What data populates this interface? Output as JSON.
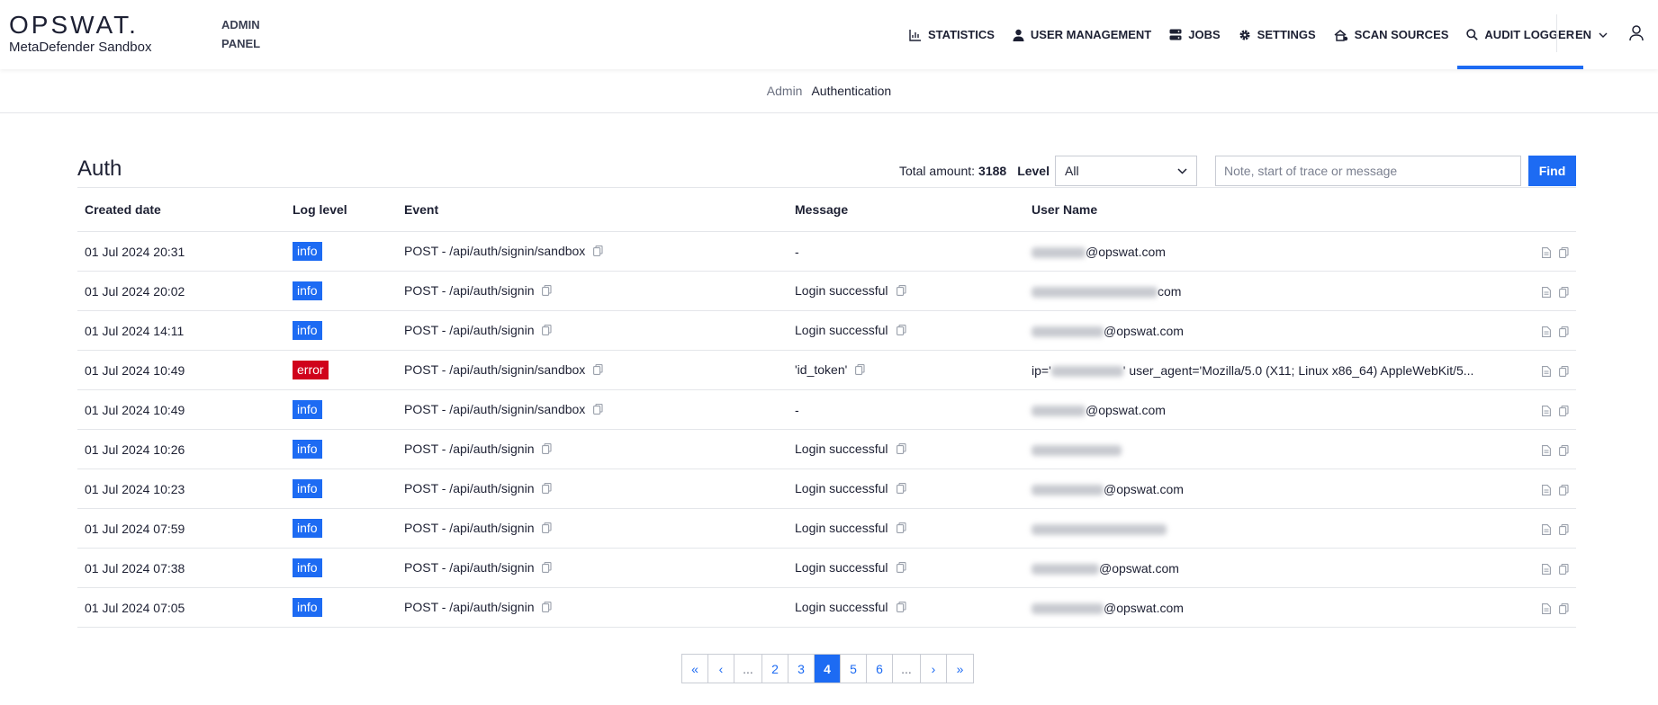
{
  "header": {
    "logo": "OPSWAT.",
    "product": "MetaDefender Sandbox",
    "panel_line1": "ADMIN",
    "panel_line2": "PANEL",
    "nav": [
      {
        "label": "STATISTICS",
        "icon": "bar-chart-icon"
      },
      {
        "label": "USER MANAGEMENT",
        "icon": "person-icon"
      },
      {
        "label": "JOBS",
        "icon": "server-icon"
      },
      {
        "label": "SETTINGS",
        "icon": "gear-icon"
      },
      {
        "label": "SCAN SOURCES",
        "icon": "cloud-scan-icon"
      },
      {
        "label": "AUDIT LOGGER",
        "icon": "search-icon",
        "active": true
      }
    ],
    "language": "EN"
  },
  "breadcrumb": [
    "Admin",
    "Authentication"
  ],
  "section": {
    "title": "Auth",
    "total_label": "Total amount:",
    "total_value": "3188",
    "level_label": "Level",
    "level_value": "All",
    "search_placeholder": "Note, start of trace or message",
    "find_label": "Find"
  },
  "table": {
    "headers": [
      "Created date",
      "Log level",
      "Event",
      "Message",
      "User Name"
    ],
    "rows": [
      {
        "date": "01 Jul 2024 20:31",
        "level": "info",
        "event": "POST - /api/auth/signin/sandbox",
        "message": "-",
        "message_copy": false,
        "user_suffix": "@opswat.com"
      },
      {
        "date": "01 Jul 2024 20:02",
        "level": "info",
        "event": "POST - /api/auth/signin",
        "message": "Login successful",
        "message_copy": true,
        "user_suffix": "com"
      },
      {
        "date": "01 Jul 2024 14:11",
        "level": "info",
        "event": "POST - /api/auth/signin",
        "message": "Login successful",
        "message_copy": true,
        "user_suffix": "@opswat.com"
      },
      {
        "date": "01 Jul 2024 10:49",
        "level": "error",
        "event": "POST - /api/auth/signin/sandbox",
        "message": "'id_token'",
        "message_copy": true,
        "user_prefix": "ip='",
        "user_suffix": "' user_agent='Mozilla/5.0 (X11; Linux x86_64) AppleWebKit/5..."
      },
      {
        "date": "01 Jul 2024 10:49",
        "level": "info",
        "event": "POST - /api/auth/signin/sandbox",
        "message": "-",
        "message_copy": false,
        "user_suffix": "@opswat.com"
      },
      {
        "date": "01 Jul 2024 10:26",
        "level": "info",
        "event": "POST - /api/auth/signin",
        "message": "Login successful",
        "message_copy": true,
        "user_suffix": ""
      },
      {
        "date": "01 Jul 2024 10:23",
        "level": "info",
        "event": "POST - /api/auth/signin",
        "message": "Login successful",
        "message_copy": true,
        "user_suffix": "@opswat.com"
      },
      {
        "date": "01 Jul 2024 07:59",
        "level": "info",
        "event": "POST - /api/auth/signin",
        "message": "Login successful",
        "message_copy": true,
        "user_suffix": ""
      },
      {
        "date": "01 Jul 2024 07:38",
        "level": "info",
        "event": "POST - /api/auth/signin",
        "message": "Login successful",
        "message_copy": true,
        "user_suffix": "@opswat.com"
      },
      {
        "date": "01 Jul 2024 07:05",
        "level": "info",
        "event": "POST - /api/auth/signin",
        "message": "Login successful",
        "message_copy": true,
        "user_suffix": "@opswat.com"
      }
    ]
  },
  "pagination": {
    "items": [
      "«",
      "‹",
      "...",
      "2",
      "3",
      "4",
      "5",
      "6",
      "...",
      "›",
      "»"
    ],
    "active": "4"
  },
  "colors": {
    "accent": "#1d6bf3",
    "error": "#d0021b"
  }
}
